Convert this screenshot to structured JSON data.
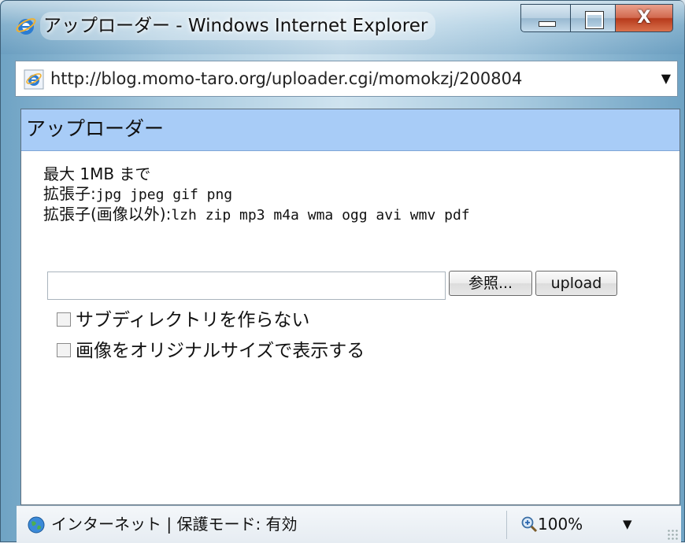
{
  "window": {
    "title": "アップローダー - Windows Internet Explorer",
    "close_glyph": "X"
  },
  "addressbar": {
    "url": "http://blog.momo-taro.org/uploader.cgi/momokzj/200804",
    "dropdown_glyph": "▼"
  },
  "page": {
    "header_title": "アップローダー",
    "info": {
      "max_size": "最大 1MB まで",
      "ext_label": "拡張子:",
      "ext_values": "jpg jpeg gif png",
      "ext_other_label": "拡張子(画像以外):",
      "ext_other_values": "lzh zip mp3 m4a wma ogg avi wmv pdf"
    },
    "file_input_value": "",
    "browse_button": "参照...",
    "upload_button": "upload",
    "options": [
      {
        "label": "サブディレクトリを作らない",
        "checked": false
      },
      {
        "label": "画像をオリジナルサイズで表示する",
        "checked": false
      }
    ]
  },
  "statusbar": {
    "zone_text": "インターネット | 保護モード: 有効",
    "zoom": "100%",
    "zoom_dropdown_glyph": "▼"
  },
  "icons": {
    "ie_logo": "ie-logo-icon",
    "globe": "globe-icon",
    "zoom": "magnifier-icon"
  }
}
